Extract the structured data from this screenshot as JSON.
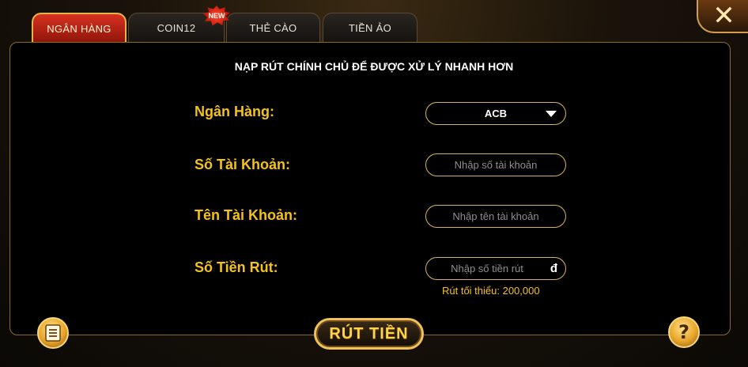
{
  "tabs": [
    {
      "label": "NGÂN HÀNG",
      "active": true
    },
    {
      "label": "COIN12",
      "badge": "NEW"
    },
    {
      "label": "THẺ CÀO"
    },
    {
      "label": "TIỀN ẢO"
    }
  ],
  "close_icon": "close-icon",
  "headline": "NẠP RÚT CHÍNH CHỦ ĐỂ ĐƯỢC XỬ LÝ NHANH HƠN",
  "form": {
    "bank_label": "Ngân Hàng:",
    "bank_value": "ACB",
    "account_number_label": "Số Tài Khoản:",
    "account_number_placeholder": "Nhập số tài  khoản",
    "account_name_label": "Tên Tài Khoản:",
    "account_name_placeholder": "Nhập tên tài khoản",
    "amount_label": "Số Tiền Rút:",
    "amount_placeholder": "Nhập số tiền rút",
    "currency_symbol": "đ",
    "min_hint": "Rút tối thiểu: 200,000"
  },
  "submit_label": "RÚT TIỀN",
  "history_icon": "document-icon",
  "help_icon": "question-icon",
  "colors": {
    "accent": "#f5c21b",
    "active_tab": "#c4231a",
    "border_gold": "#d7b35a"
  }
}
